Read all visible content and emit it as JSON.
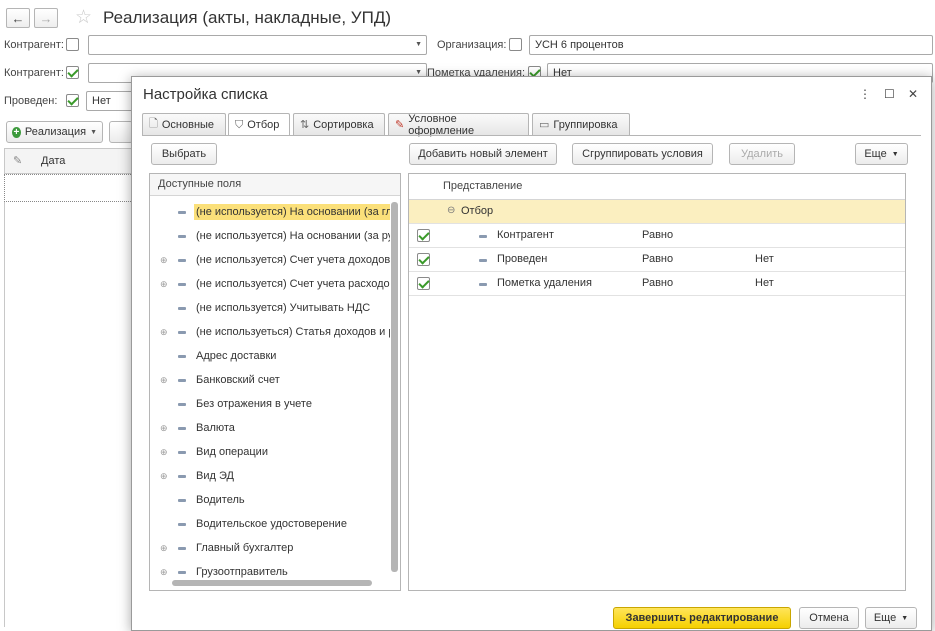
{
  "background": {
    "title": "Реализация (акты, накладные, УПД)",
    "filters": {
      "kontragent1_label": "Контрагент:",
      "org_label": "Организация:",
      "org_value": "УСН 6 процентов",
      "kontragent2_label": "Контрагент:",
      "pometka_label": "Пометка удаления:",
      "pometka_value": "Нет",
      "proveden_label": "Проведен:",
      "proveden_value": "Нет"
    },
    "create_button": "Реализация",
    "column_date": "Дата"
  },
  "dialog": {
    "title": "Настройка списка",
    "tabs": [
      {
        "label": "Основные",
        "icon": "document-icon"
      },
      {
        "label": "Отбор",
        "icon": "filter-icon"
      },
      {
        "label": "Сортировка",
        "icon": "sort-icon"
      },
      {
        "label": "Условное оформление",
        "icon": "pencil-icon"
      },
      {
        "label": "Группировка",
        "icon": "group-icon"
      }
    ],
    "select_button": "Выбрать",
    "add_button": "Добавить новый элемент",
    "group_button": "Сгруппировать условия",
    "delete_button": "Удалить",
    "more_button": "Еще",
    "fields_header": "Доступные поля",
    "fields": [
      {
        "label": "(не используется) На основании (за гл",
        "expandable": false,
        "selected": true
      },
      {
        "label": "(не используется) На основании (за ру",
        "expandable": false,
        "selected": false
      },
      {
        "label": "(не используется) Счет учета доходов",
        "expandable": true,
        "selected": false
      },
      {
        "label": "(не используется) Счет учета расходо",
        "expandable": true,
        "selected": false
      },
      {
        "label": "(не используется) Учитывать НДС",
        "expandable": false,
        "selected": false
      },
      {
        "label": "(не используеться) Статья доходов и р",
        "expandable": true,
        "selected": false
      },
      {
        "label": "Адрес доставки",
        "expandable": false,
        "selected": false
      },
      {
        "label": "Банковский счет",
        "expandable": true,
        "selected": false
      },
      {
        "label": "Без отражения в учете",
        "expandable": false,
        "selected": false
      },
      {
        "label": "Валюта",
        "expandable": true,
        "selected": false
      },
      {
        "label": "Вид операции",
        "expandable": true,
        "selected": false
      },
      {
        "label": "Вид ЭД",
        "expandable": true,
        "selected": false
      },
      {
        "label": "Водитель",
        "expandable": false,
        "selected": false
      },
      {
        "label": "Водительское удостоверение",
        "expandable": false,
        "selected": false
      },
      {
        "label": "Главный бухгалтер",
        "expandable": true,
        "selected": false
      },
      {
        "label": "Грузоотправитель",
        "expandable": true,
        "selected": false
      }
    ],
    "filter_header": "Представление",
    "filter_group": "Отбор",
    "filter_rows": [
      {
        "field": "Контрагент",
        "condition": "Равно",
        "value": "",
        "checked": true
      },
      {
        "field": "Проведен",
        "condition": "Равно",
        "value": "Нет",
        "checked": true
      },
      {
        "field": "Пометка удаления",
        "condition": "Равно",
        "value": "Нет",
        "checked": true
      }
    ],
    "finish_button": "Завершить редактирование",
    "cancel_button": "Отмена",
    "more_button_bottom": "Еще"
  }
}
